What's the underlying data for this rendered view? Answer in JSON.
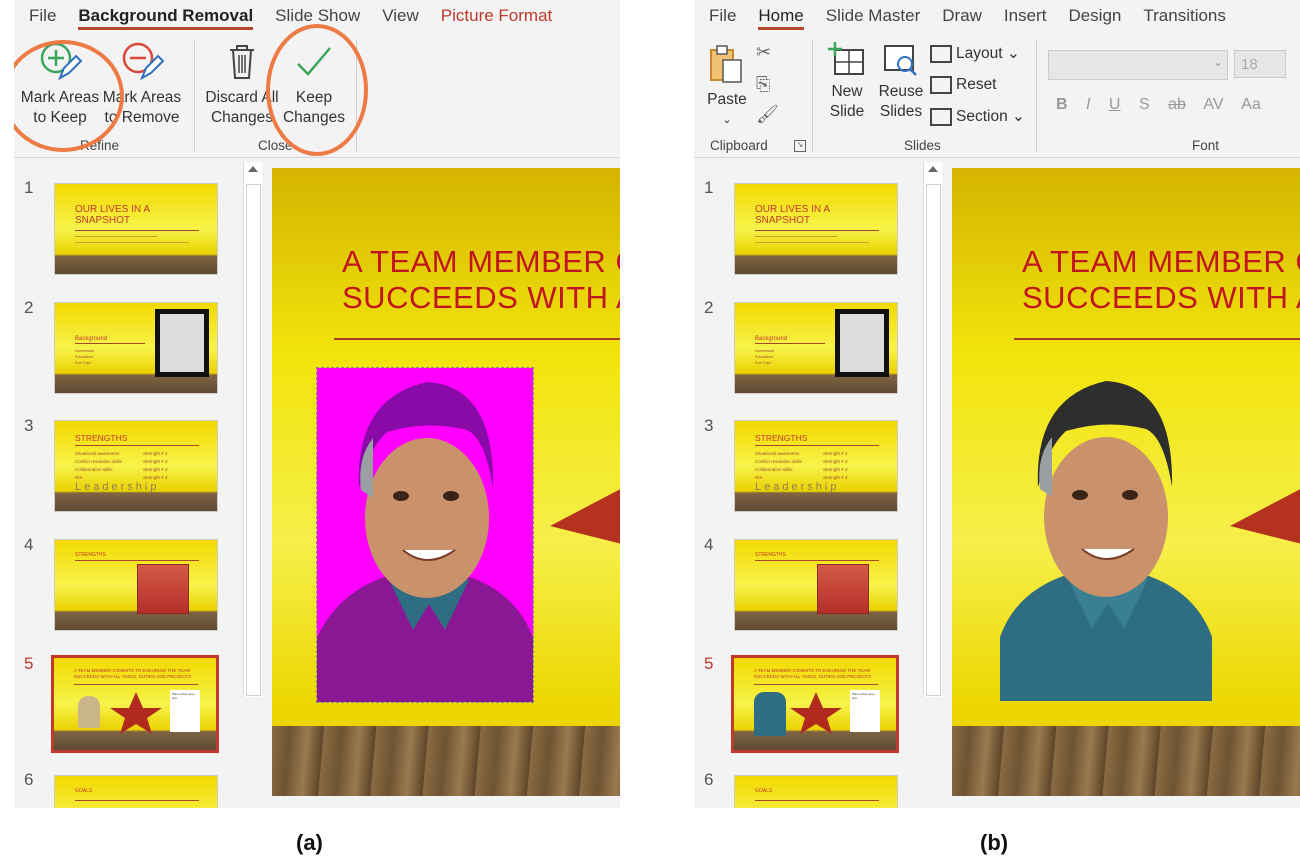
{
  "panel_a": {
    "tabs": [
      "File",
      "Background Removal",
      "Slide Show",
      "View",
      "Picture Format"
    ],
    "buttons": {
      "mark_keep": [
        "Mark Areas",
        "to Keep"
      ],
      "mark_remove": [
        "Mark Areas",
        "to Remove"
      ],
      "discard": [
        "Discard All",
        "Changes"
      ],
      "keep_changes": [
        "Keep",
        "Changes"
      ]
    },
    "groups": {
      "refine": "Refine",
      "close": "Close"
    },
    "caption": "(a)"
  },
  "panel_b": {
    "tabs": [
      "File",
      "Home",
      "Slide Master",
      "Draw",
      "Insert",
      "Design",
      "Transitions"
    ],
    "buttons": {
      "paste": "Paste",
      "new_slide": [
        "New",
        "Slide"
      ],
      "reuse_slides": [
        "Reuse",
        "Slides"
      ],
      "layout": "Layout",
      "reset": "Reset",
      "section": "Section"
    },
    "font_size": "18",
    "font_buttons": [
      "B",
      "I",
      "U",
      "S",
      "ab",
      "AV",
      "Aa"
    ],
    "groups": {
      "clipboard": "Clipboard",
      "slides": "Slides",
      "font": "Font"
    },
    "caption": "(b)"
  },
  "thumbnails": [
    {
      "num": "1",
      "title": "OUR LIVES IN A SNAPSHOT"
    },
    {
      "num": "2",
      "title": "Background",
      "items": [
        "Hometown",
        "Education",
        "Fun Fact"
      ]
    },
    {
      "num": "3",
      "title": "STRENGTHS",
      "items": [
        "Situational awareness",
        "Conflict resolution skills",
        "Collaboration skills",
        "Grit"
      ],
      "items2": [
        "Strength # 1",
        "Strength # 2",
        "Strength # 3",
        "Strength # 4"
      ],
      "wordart": "Leadership"
    },
    {
      "num": "4",
      "title": "STRENGTHS"
    },
    {
      "num": "5",
      "title": "A TEAM MEMBER COMMITS TO ENSURING THE TEAM SUCCEEDS WITH ALL TASKS, DUTIES AND PROJECTS",
      "note": "Place photo grey text"
    },
    {
      "num": "6",
      "title": "GOALS"
    }
  ],
  "slide": {
    "title_line1": "A TEAM MEMBER C",
    "title_line2": "SUCCEEDS WITH A"
  },
  "colors": {
    "accent": "#b7472a",
    "highlight": "#ee7a45",
    "slide_title": "#c0141e",
    "bg_removal": "#ff00ff"
  }
}
